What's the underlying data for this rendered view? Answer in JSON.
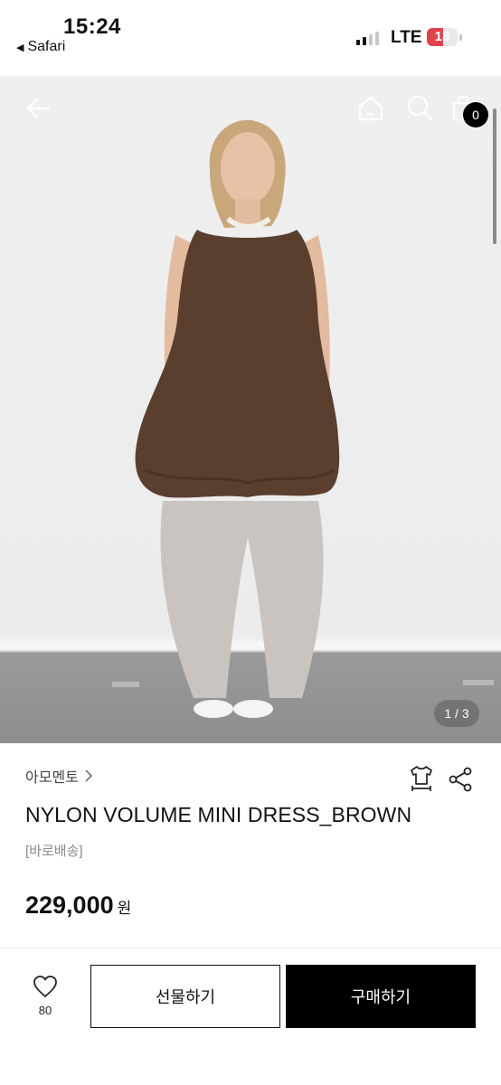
{
  "status_bar": {
    "time": "15:24",
    "back_app": "Safari",
    "network": "LTE",
    "battery": "18"
  },
  "header": {
    "cart_count": "0"
  },
  "gallery": {
    "counter": "1 / 3"
  },
  "product": {
    "brand": "아모멘토",
    "title": "NYLON VOLUME MINI DRESS_BROWN",
    "delivery_tag": "[바로배송]",
    "price": "229,000",
    "currency": "원"
  },
  "actions": {
    "like_count": "80",
    "gift_label": "선물하기",
    "buy_label": "구매하기"
  },
  "icons": [
    "arrow-left-icon",
    "home-icon",
    "search-icon",
    "shopping-bag-icon",
    "chevron-right-icon",
    "size-guide-icon",
    "share-icon",
    "heart-icon"
  ],
  "colors": {
    "buy_button": "#000000",
    "dress": "#5a3e2e",
    "badge": "#000000"
  }
}
